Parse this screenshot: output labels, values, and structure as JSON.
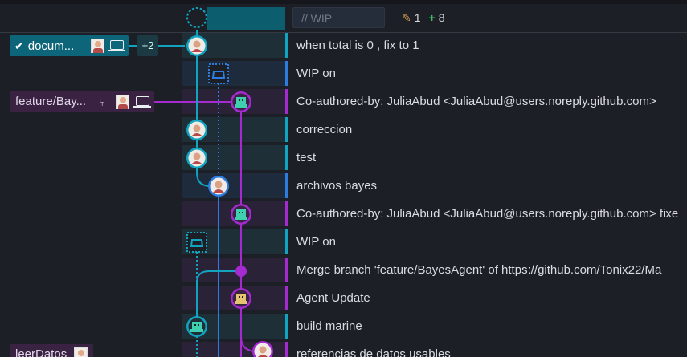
{
  "wip": {
    "placeholder": "// WIP",
    "edited_count": "1",
    "added_count": "8"
  },
  "branches": {
    "documentation": {
      "label": "docum...",
      "extra": "+2"
    },
    "feature": {
      "label": "feature/Bay..."
    },
    "leer": {
      "label": "leerDatos"
    }
  },
  "commits": [
    {
      "message": "when total is 0 , fix to 1"
    },
    {
      "message": "WIP on"
    },
    {
      "message": "Co-authored-by: JuliaAbud <JuliaAbud@users.noreply.github.com>"
    },
    {
      "message": "correccion"
    },
    {
      "message": "test"
    },
    {
      "message": "archivos bayes"
    },
    {
      "message": "Co-authored-by: JuliaAbud <JuliaAbud@users.noreply.github.com> fixe"
    },
    {
      "message": "WIP on"
    },
    {
      "message": "Merge branch 'feature/BayesAgent' of https://github.com/Tonix22/Ma"
    },
    {
      "message": "Agent Update"
    },
    {
      "message": "build marine"
    },
    {
      "message": "referencias de datos usables"
    }
  ],
  "colors": {
    "teal": "#11a3bf",
    "blue": "#2d7de0",
    "purple": "#a52bd1",
    "background": "#1c1f26"
  },
  "icons": [
    "check-icon",
    "laptop-icon",
    "branch-icon",
    "pencil-icon",
    "plus-icon",
    "avatar-icon",
    "stash-icon",
    "pixel-avatar-icon"
  ]
}
